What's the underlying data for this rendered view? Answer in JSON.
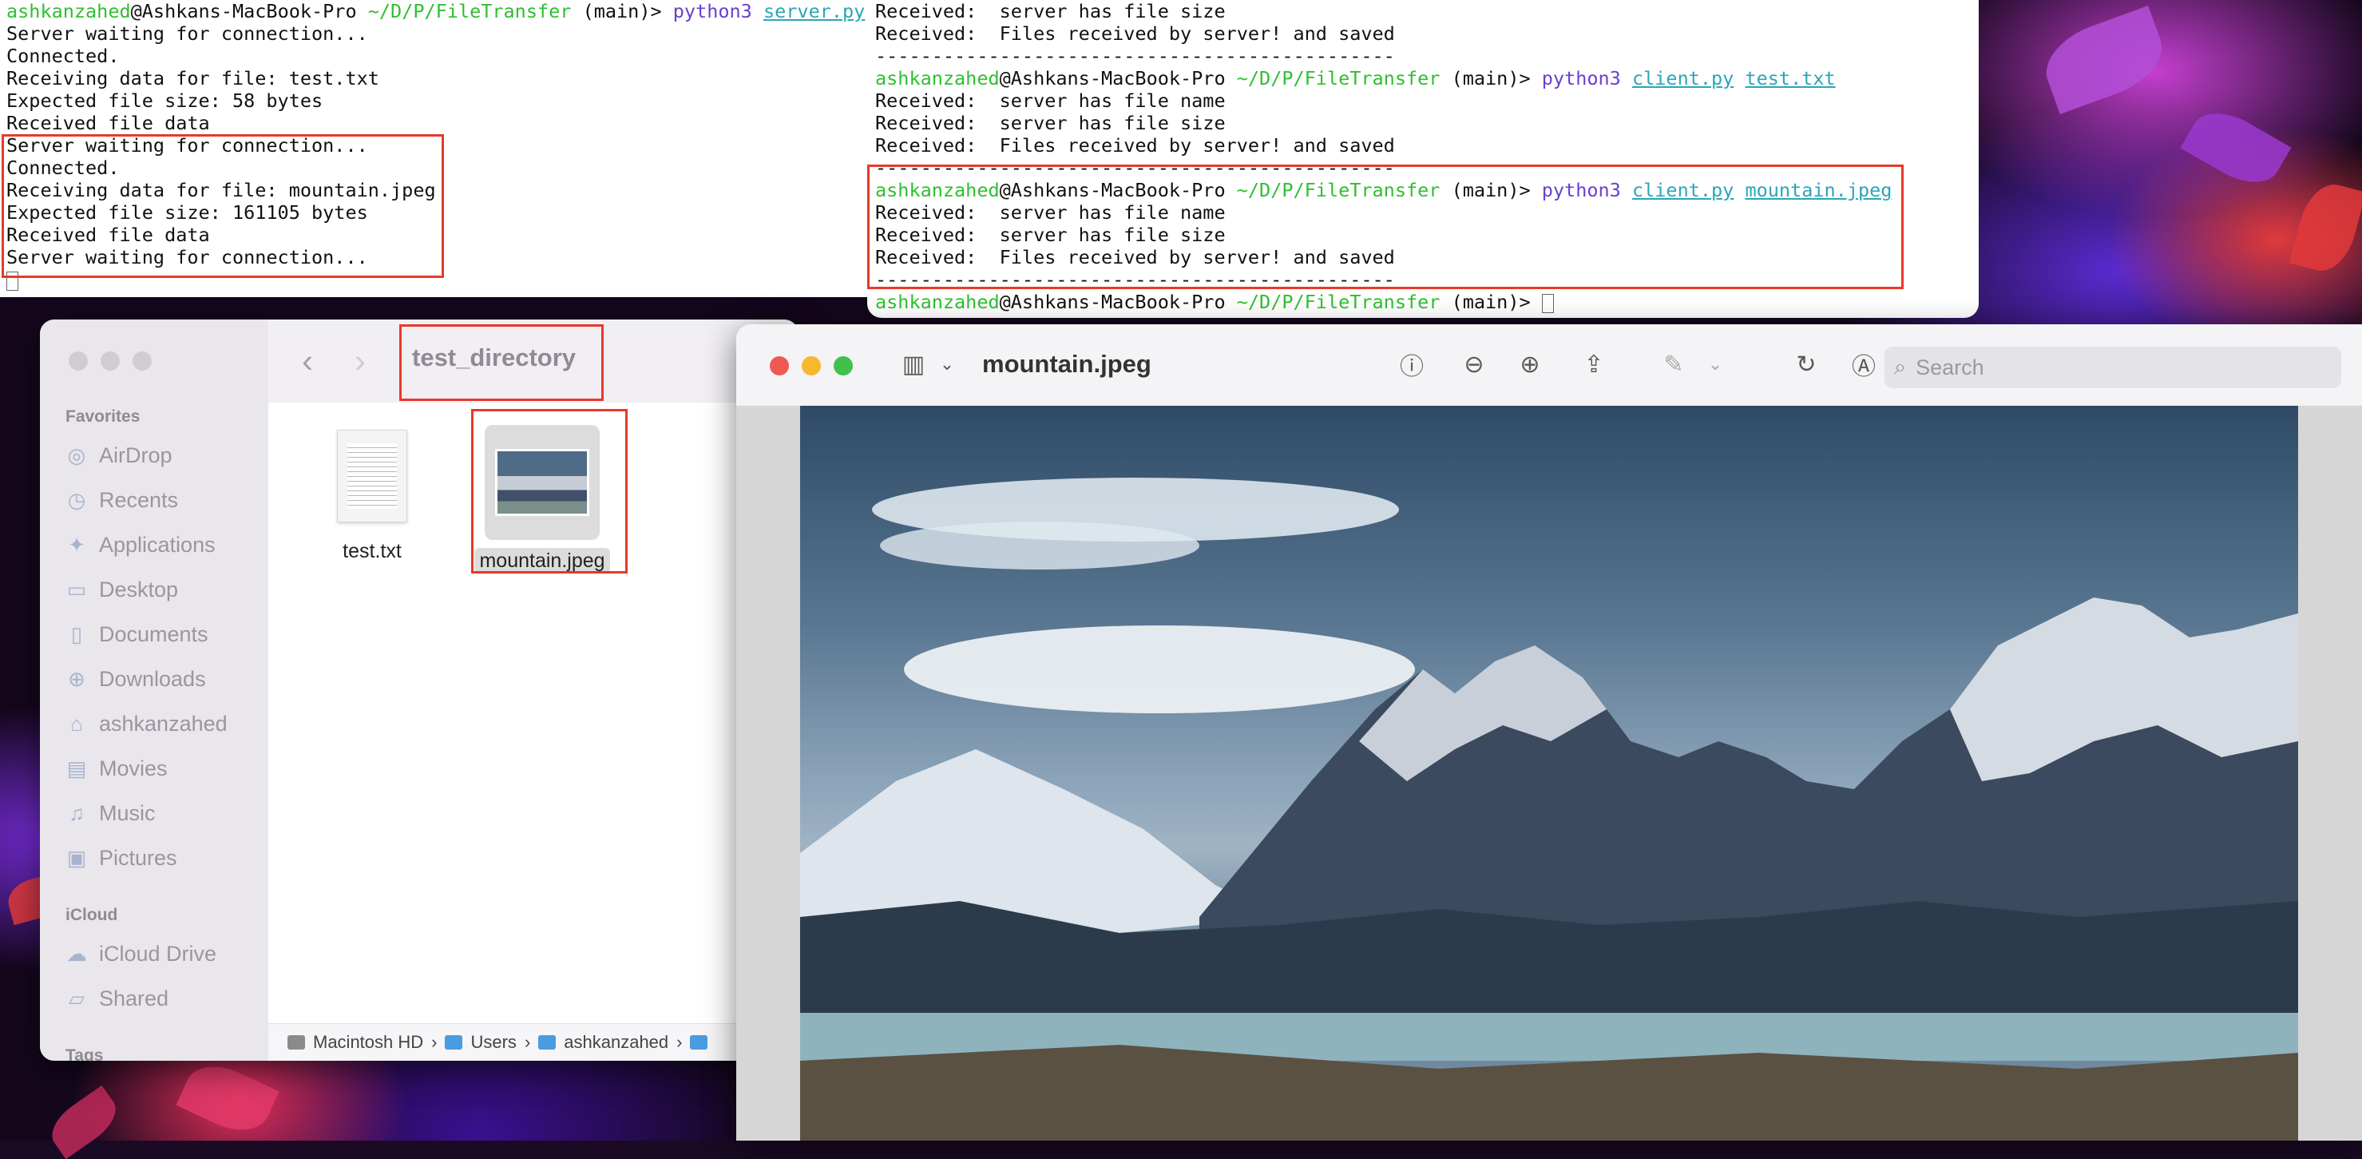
{
  "terminal_left": {
    "lines": [
      {
        "user": "ashkanzahed",
        "host": "@Ashkans-MacBook-Pro",
        "path": " ~/D/P/FileTransfer",
        "branch": " (main)> ",
        "cmd": "python3",
        "file1": "server.py"
      },
      {
        "text": "Server waiting for connection..."
      },
      {
        "text": "Connected."
      },
      {
        "text": "Receiving data for file: test.txt"
      },
      {
        "text": "Expected file size: 58 bytes"
      },
      {
        "text": "Received file data"
      },
      {
        "text": "Server waiting for connection..."
      },
      {
        "text": "Connected."
      },
      {
        "text": "Receiving data for file: mountain.jpeg"
      },
      {
        "text": "Expected file size: 161105 bytes"
      },
      {
        "text": "Received file data"
      },
      {
        "text": "Server waiting for connection..."
      }
    ]
  },
  "terminal_right": {
    "lines": [
      {
        "text": "Received:  server has file size"
      },
      {
        "text": "Received:  Files received by server! and saved"
      },
      {
        "text": "----------------------------------------------"
      },
      {
        "user": "ashkanzahed",
        "host": "@Ashkans-MacBook-Pro",
        "path": " ~/D/P/FileTransfer",
        "branch": " (main)> ",
        "cmd": "python3",
        "file1": "client.py",
        "file2": "test.txt"
      },
      {
        "text": "Received:  server has file name"
      },
      {
        "text": "Received:  server has file size"
      },
      {
        "text": "Received:  Files received by server! and saved"
      },
      {
        "text": "----------------------------------------------"
      },
      {
        "user": "ashkanzahed",
        "host": "@Ashkans-MacBook-Pro",
        "path": " ~/D/P/FileTransfer",
        "branch": " (main)> ",
        "cmd": "python3",
        "file1": "client.py",
        "file2": "mountain.jpeg"
      },
      {
        "text": "Received:  server has file name"
      },
      {
        "text": "Received:  server has file size"
      },
      {
        "text": "Received:  Files received by server! and saved"
      },
      {
        "text": "----------------------------------------------"
      },
      {
        "user": "ashkanzahed",
        "host": "@Ashkans-MacBook-Pro",
        "path": " ~/D/P/FileTransfer",
        "branch": " (main)> "
      }
    ]
  },
  "finder": {
    "title": "test_directory",
    "favorites_heading": "Favorites",
    "favorites": [
      {
        "label": "AirDrop",
        "icon": "airdrop-icon"
      },
      {
        "label": "Recents",
        "icon": "clock-icon"
      },
      {
        "label": "Applications",
        "icon": "applications-icon"
      },
      {
        "label": "Desktop",
        "icon": "desktop-icon"
      },
      {
        "label": "Documents",
        "icon": "document-icon"
      },
      {
        "label": "Downloads",
        "icon": "download-icon"
      },
      {
        "label": "ashkanzahed",
        "icon": "home-icon"
      },
      {
        "label": "Movies",
        "icon": "film-icon"
      },
      {
        "label": "Music",
        "icon": "music-icon"
      },
      {
        "label": "Pictures",
        "icon": "photo-icon"
      }
    ],
    "icloud_heading": "iCloud",
    "icloud": [
      {
        "label": "iCloud Drive",
        "icon": "cloud-icon"
      },
      {
        "label": "Shared",
        "icon": "shared-folder-icon"
      }
    ],
    "tags_heading": "Tags",
    "files": [
      {
        "name": "test.txt",
        "icon": "text-file-icon"
      },
      {
        "name": "mountain.jpeg",
        "icon": "image-file-icon",
        "selected": true
      }
    ],
    "path": [
      "Macintosh HD",
      "Users",
      "ashkanzahed"
    ]
  },
  "preview": {
    "title": "mountain.jpeg",
    "search_placeholder": "Search"
  },
  "colors": {
    "highlight_box": "#e8392a",
    "prompt_green": "#2fbf2f",
    "command_purple": "#6a3fd0",
    "file_teal": "#2aa6b8"
  }
}
